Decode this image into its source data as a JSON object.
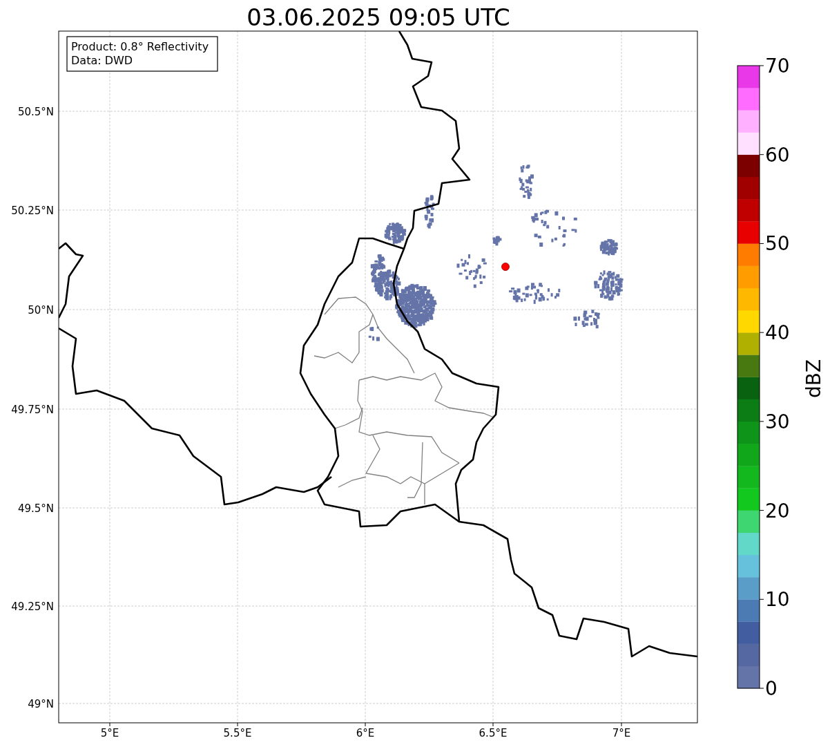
{
  "title": "03.06.2025 09:05 UTC",
  "info_box": [
    "Product: 0.8° Reflectivity",
    "Data: DWD"
  ],
  "map": {
    "x_ticks": [
      "5°E",
      "5.5°E",
      "6°E",
      "6.5°E",
      "7°E"
    ],
    "y_ticks": [
      "50.5°N",
      "50.25°N",
      "50°N",
      "49.75°N",
      "49.5°N",
      "49.25°N",
      "49°N"
    ]
  },
  "colorbar": {
    "label": "dBZ",
    "ticks": [
      "70",
      "60",
      "50",
      "40",
      "30",
      "20",
      "10",
      "0"
    ],
    "bins": [
      {
        "color": "#6574a8"
      },
      {
        "color": "#5668a2"
      },
      {
        "color": "#435ea0"
      },
      {
        "color": "#4b7bb2"
      },
      {
        "color": "#5a9dc8"
      },
      {
        "color": "#66c2dc"
      },
      {
        "color": "#62d8c8"
      },
      {
        "color": "#3ed670"
      },
      {
        "color": "#12c81e"
      },
      {
        "color": "#12b81e"
      },
      {
        "color": "#10a81a"
      },
      {
        "color": "#0e9418"
      },
      {
        "color": "#0c7c14"
      },
      {
        "color": "#086210"
      },
      {
        "color": "#487810"
      },
      {
        "color": "#b0b000"
      },
      {
        "color": "#ffd800"
      },
      {
        "color": "#ffb800"
      },
      {
        "color": "#ff9c00"
      },
      {
        "color": "#ff7c00"
      },
      {
        "color": "#e80000"
      },
      {
        "color": "#c00000"
      },
      {
        "color": "#a00000"
      },
      {
        "color": "#7c0000"
      },
      {
        "color": "#ffe0ff"
      },
      {
        "color": "#ffb0ff"
      },
      {
        "color": "#ff6cff"
      },
      {
        "color": "#e838e8"
      }
    ]
  }
}
